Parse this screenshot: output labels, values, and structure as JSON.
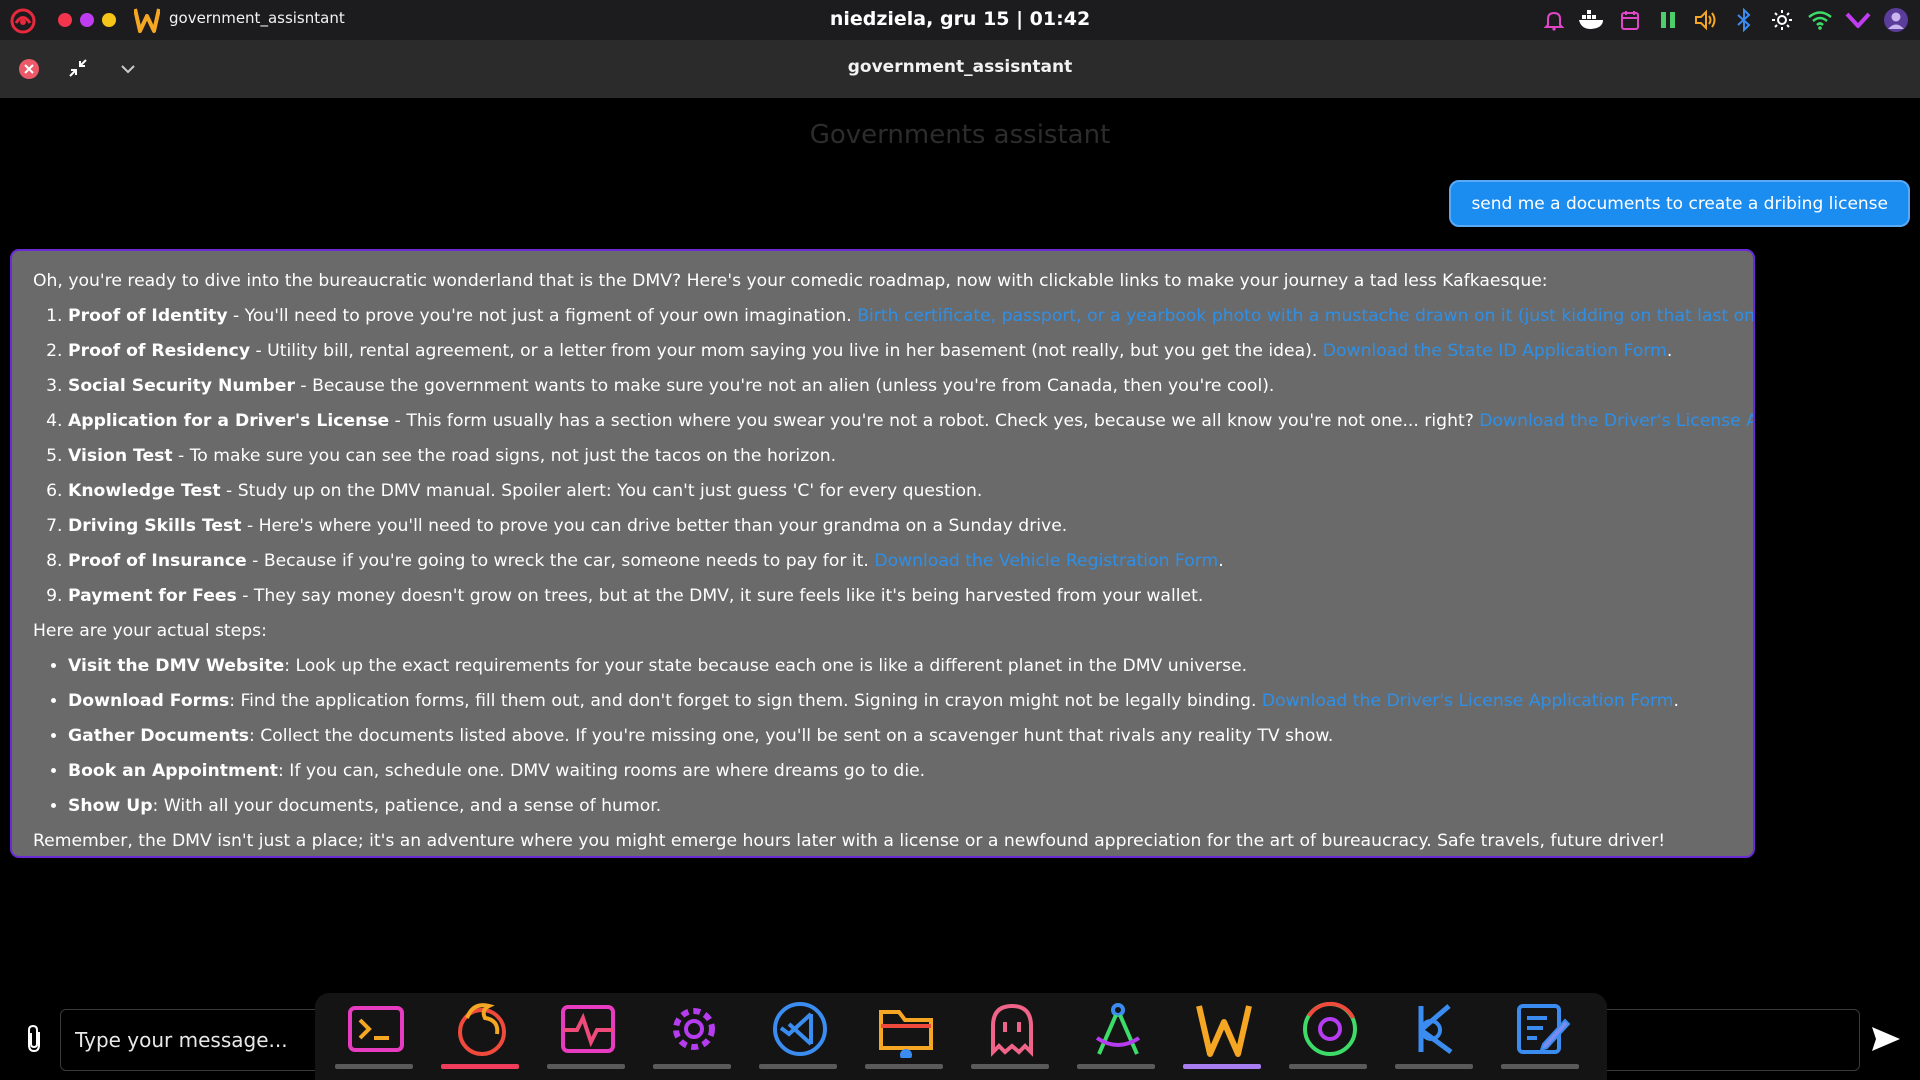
{
  "topbar": {
    "app_name": "government_assisntant",
    "clock": "niedziela, gru 15 | 01:42",
    "traffic_colors": [
      "#f2344c",
      "#c03cf0",
      "#f5c518"
    ],
    "tray_icons": [
      "bell-icon",
      "docker-icon",
      "calendar-icon",
      "pause-icon",
      "volume-icon",
      "bluetooth-icon",
      "brightness-icon",
      "wifi-icon",
      "chevron-down-icon",
      "avatar-icon"
    ]
  },
  "window": {
    "title": "government_assisntant"
  },
  "chat": {
    "heading": "Governments assistant",
    "user_message": "send me a documents to create a dribing license",
    "ai": {
      "intro": "Oh, you're ready to dive into the bureaucratic wonderland that is the DMV? Here's your comedic roadmap, now with clickable links to make your journey a tad less Kafkaesque:",
      "numbered": [
        {
          "title": "Proof of Identity",
          "text": " - You'll need to prove you're not just a figment of your own imagination. ",
          "link": "Birth certificate, passport, or a yearbook photo with a mustache drawn on it (just kidding on that last one)",
          "after": "."
        },
        {
          "title": "Proof of Residency",
          "text": " - Utility bill, rental agreement, or a letter from your mom saying you live in her basement (not really, but you get the idea). ",
          "link": "Download the State ID Application Form",
          "after": "."
        },
        {
          "title": "Social Security Number",
          "text": " - Because the government wants to make sure you're not an alien (unless you're from Canada, then you're cool).",
          "link": "",
          "after": ""
        },
        {
          "title": "Application for a Driver's License",
          "text": " - This form usually has a section where you swear you're not a robot. Check yes, because we all know you're not one... right? ",
          "link": "Download the Driver's License Application Form",
          "after": "."
        },
        {
          "title": "Vision Test",
          "text": " - To make sure you can see the road signs, not just the tacos on the horizon.",
          "link": "",
          "after": ""
        },
        {
          "title": "Knowledge Test",
          "text": " - Study up on the DMV manual. Spoiler alert: You can't just guess 'C' for every question.",
          "link": "",
          "after": ""
        },
        {
          "title": "Driving Skills Test",
          "text": " - Here's where you'll need to prove you can drive better than your grandma on a Sunday drive.",
          "link": "",
          "after": ""
        },
        {
          "title": "Proof of Insurance",
          "text": " - Because if you're going to wreck the car, someone needs to pay for it. ",
          "link": "Download the Vehicle Registration Form",
          "after": "."
        },
        {
          "title": "Payment for Fees",
          "text": " - They say money doesn't grow on trees, but at the DMV, it sure feels like it's being harvested from your wallet.",
          "link": "",
          "after": ""
        }
      ],
      "steps_heading": "Here are your actual steps:",
      "steps": [
        {
          "title": "Visit the DMV Website",
          "text": ": Look up the exact requirements for your state because each one is like a different planet in the DMV universe.",
          "link": "",
          "after": ""
        },
        {
          "title": "Download Forms",
          "text": ": Find the application forms, fill them out, and don't forget to sign them. Signing in crayon might not be legally binding. ",
          "link": "Download the Driver's License Application Form",
          "after": "."
        },
        {
          "title": "Gather Documents",
          "text": ": Collect the documents listed above. If you're missing one, you'll be sent on a scavenger hunt that rivals any reality TV show.",
          "link": "",
          "after": ""
        },
        {
          "title": "Book an Appointment",
          "text": ": If you can, schedule one. DMV waiting rooms are where dreams go to die.",
          "link": "",
          "after": ""
        },
        {
          "title": "Show Up",
          "text": ": With all your documents, patience, and a sense of humor.",
          "link": "",
          "after": ""
        }
      ],
      "outro": "Remember, the DMV isn't just a place; it's an adventure where you might emerge hours later with a license or a newfound appreciation for the art of bureaucracy. Safe travels, future driver!"
    }
  },
  "input": {
    "placeholder": "Type your message..."
  },
  "dock": {
    "items": [
      {
        "name": "terminal-icon",
        "state": "open"
      },
      {
        "name": "firefox-icon",
        "state": "active"
      },
      {
        "name": "system-monitor-icon",
        "state": "open"
      },
      {
        "name": "settings-gear-icon",
        "state": "open"
      },
      {
        "name": "vscode-icon",
        "state": "open"
      },
      {
        "name": "file-manager-icon",
        "state": "open"
      },
      {
        "name": "ghost-icon",
        "state": "open"
      },
      {
        "name": "drafting-compass-icon",
        "state": "open"
      },
      {
        "name": "w-app-icon",
        "state": "focused"
      },
      {
        "name": "chrome-icon",
        "state": "open"
      },
      {
        "name": "kde-connect-icon",
        "state": "open"
      },
      {
        "name": "text-editor-icon",
        "state": "open"
      }
    ]
  },
  "colors": {
    "user_bubble": "#1c8df0",
    "ai_bubble": "#6a6a6a",
    "ai_border": "#6a2bd6",
    "link": "#2f8fe6"
  }
}
